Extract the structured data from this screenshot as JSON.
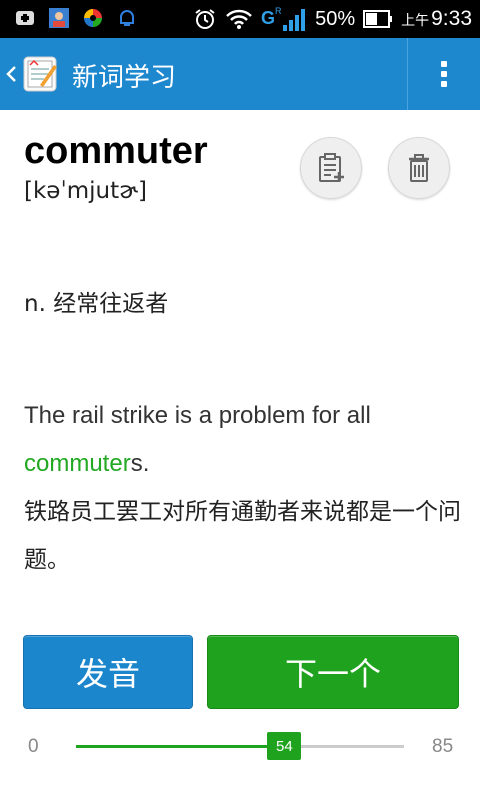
{
  "status_bar": {
    "battery_pct": "50%",
    "time_prefix": "上午",
    "time": "9:33",
    "network": "G"
  },
  "action_bar": {
    "title": "新词学习",
    "accent": "#1e88cf"
  },
  "word": {
    "headword": "commuter",
    "phonetic": "[kəˈmjutɚ]",
    "definition": "n. 经常往返者"
  },
  "example": {
    "en_before": "The rail strike is a problem for all ",
    "en_highlight": "commuter",
    "en_after": "s.",
    "zh": "铁路员工罢工对所有通勤者来说都是一个问题。",
    "highlight_color": "#22a822"
  },
  "buttons": {
    "pronounce": "发音",
    "next": "下一个"
  },
  "progress": {
    "min": "0",
    "max": "85",
    "value": 54
  },
  "icons": [
    "back-arrow-icon",
    "app-logo-icon",
    "overflow-menu-icon",
    "add-to-wordbook-icon",
    "trash-icon"
  ]
}
